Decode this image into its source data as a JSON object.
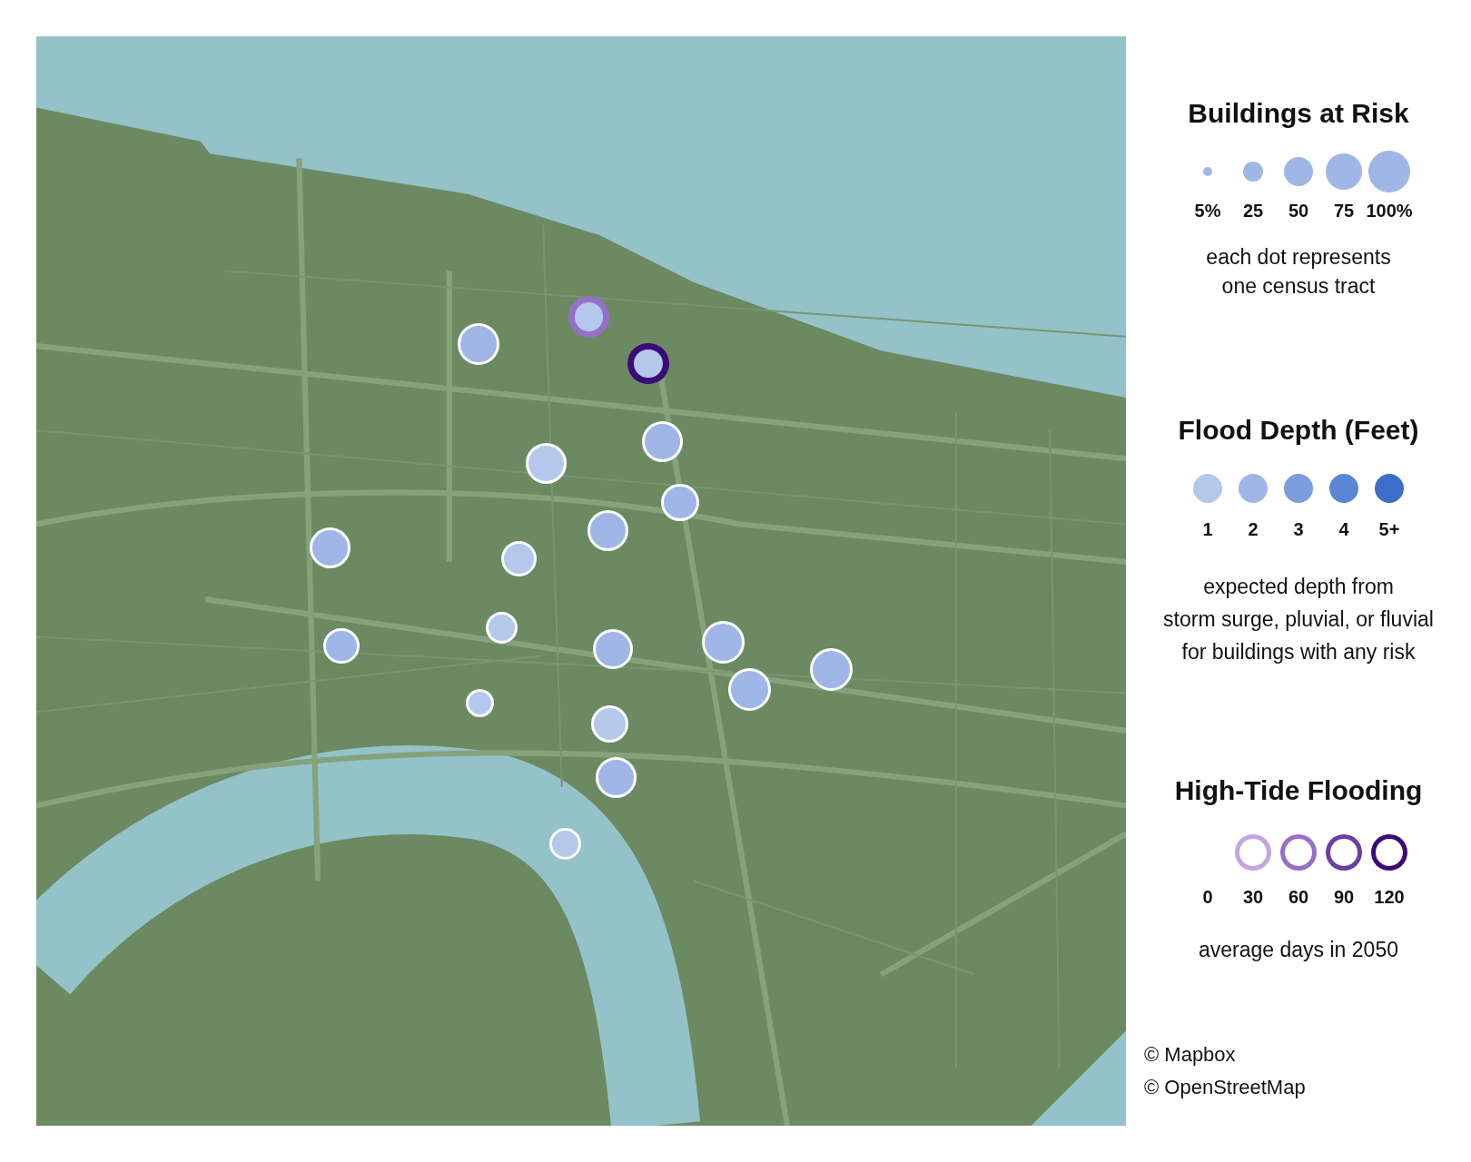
{
  "map": {
    "tracts": [
      {
        "color": "#b4c8ec",
        "ring": {
          "color": "#9670c6"
        }
      },
      {
        "color": "#9fb6e6"
      },
      {
        "color": "#b4c8ec",
        "ring": {
          "color": "#3c0a78"
        }
      },
      {
        "color": "#9fb6e6"
      },
      {
        "color": "#b4c8ec"
      },
      {
        "color": "#9fb6e6"
      },
      {
        "color": "#9fb6e6"
      },
      {
        "color": "#9fb6e6"
      },
      {
        "color": "#b4c8ec"
      },
      {
        "color": "#b4c8ec"
      },
      {
        "color": "#9fb6e6"
      },
      {
        "color": "#9fb6e6"
      },
      {
        "color": "#9fb6e6"
      },
      {
        "color": "#9fb6e6"
      },
      {
        "color": "#9fb6e6"
      },
      {
        "color": "#b4c8ec"
      },
      {
        "color": "#b4c8ec"
      },
      {
        "color": "#9fb6e6"
      },
      {
        "color": "#b4c8ec"
      }
    ]
  },
  "legend": {
    "buildings": {
      "title": "Buildings at Risk",
      "items": [
        {
          "label": "5%"
        },
        {
          "label": "25"
        },
        {
          "label": "50"
        },
        {
          "label": "75"
        },
        {
          "label": "100%"
        }
      ],
      "note": [
        "each dot represents",
        "one census tract"
      ]
    },
    "depth": {
      "title": "Flood Depth (Feet)",
      "items": [
        {
          "label": "1",
          "color": "#b4c8ec"
        },
        {
          "label": "2",
          "color": "#9fb6e6"
        },
        {
          "label": "3",
          "color": "#7c9ddc"
        },
        {
          "label": "4",
          "color": "#5b86d4"
        },
        {
          "label": "5+",
          "color": "#3d6fc9"
        }
      ],
      "note": [
        "expected depth from",
        "storm surge, pluvial, or fluvial",
        "for buildings with any risk"
      ]
    },
    "tide": {
      "title": "High-Tide Flooding",
      "items": [
        {
          "label": "0"
        },
        {
          "label": "30",
          "color": "#c4a5e0"
        },
        {
          "label": "60",
          "color": "#9670c6"
        },
        {
          "label": "90",
          "color": "#6a3fa3"
        },
        {
          "label": "120",
          "color": "#3c0a78"
        }
      ],
      "note": [
        "average days in 2050"
      ]
    }
  },
  "credits": [
    "© Mapbox",
    "© OpenStreetMap"
  ]
}
